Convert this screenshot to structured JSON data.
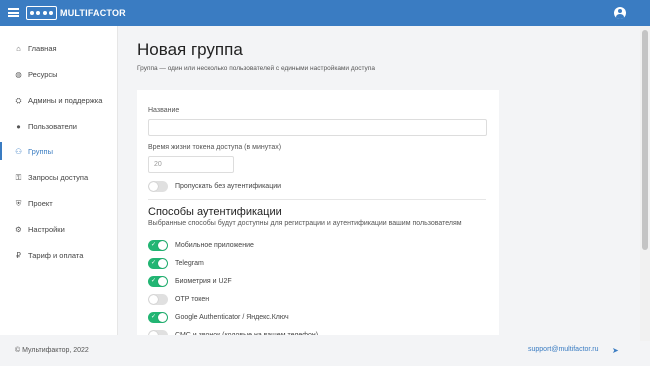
{
  "topbar": {
    "logo_text": "MULTIFACTOR"
  },
  "sidebar": {
    "items": [
      {
        "label": "Главная",
        "icon": "home-icon",
        "glyph": "⌂"
      },
      {
        "label": "Ресурсы",
        "icon": "globe-icon",
        "glyph": "◍"
      },
      {
        "label": "Админы и поддержка",
        "icon": "admin-icon",
        "glyph": "⛭"
      },
      {
        "label": "Пользователи",
        "icon": "user-icon",
        "glyph": "●"
      },
      {
        "label": "Группы",
        "icon": "group-icon",
        "glyph": "⚇"
      },
      {
        "label": "Запросы доступа",
        "icon": "key-icon",
        "glyph": "⚿"
      },
      {
        "label": "Проект",
        "icon": "shield-icon",
        "glyph": "⛨"
      },
      {
        "label": "Настройки",
        "icon": "gear-icon",
        "glyph": "⚙"
      },
      {
        "label": "Тариф и оплата",
        "icon": "ruble-icon",
        "glyph": "₽"
      }
    ]
  },
  "main": {
    "title": "Новая группа",
    "subtitle": "Группа — один или несколько пользователей с едиными настройками доступа"
  },
  "form": {
    "name_label": "Название",
    "name_value": "",
    "token_label": "Время жизни токена доступа (в минутах)",
    "token_placeholder": "20",
    "skip_auth_label": "Пропускать без аутентификации",
    "skip_auth_on": false
  },
  "auth": {
    "title": "Способы аутентификации",
    "description": "Выбранные способы будут доступны для регистрации и аутентификации вашим пользователям",
    "methods": [
      {
        "label": "Мобильное приложение",
        "on": true
      },
      {
        "label": "Telegram",
        "on": true
      },
      {
        "label": "Биометрия и U2F",
        "on": true
      },
      {
        "label": "OTP токен",
        "on": false
      },
      {
        "label": "Google Authenticator / Яндекс.Ключ",
        "on": true
      },
      {
        "label": "СМС и звонок (кодовые на вашем телефон)",
        "on": false
      }
    ]
  },
  "footer": {
    "copyright": "© Мультифактор, 2022",
    "support_email": "support@multifactor.ru"
  },
  "colors": {
    "primary": "#3a7cc2",
    "toggle_on": "#22b573"
  }
}
